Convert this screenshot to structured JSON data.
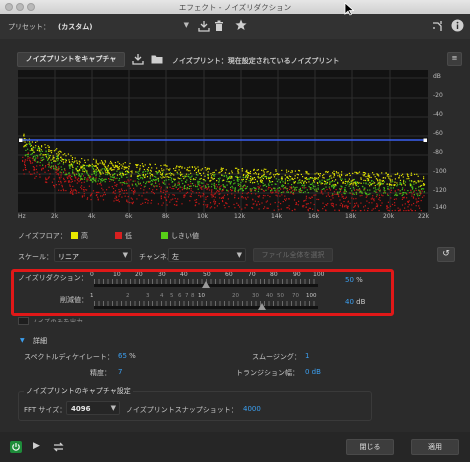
{
  "window": {
    "title": "エフェクト - ノイズリダクション"
  },
  "toolbar": {
    "preset_label": "プリセット：",
    "preset_value": "(カスタム)"
  },
  "capture": {
    "button_label": "ノイズプリントをキャプチャ",
    "status": "ノイズプリント：現在設定されているノイズプリント"
  },
  "graph": {
    "db_labels": [
      "dB",
      "-20",
      "-40",
      "-60",
      "-80",
      "-100",
      "-120",
      "-140"
    ],
    "hz_labels": [
      "Hz",
      "2k",
      "4k",
      "6k",
      "8k",
      "10k",
      "12k",
      "14k",
      "16k",
      "18k",
      "20k",
      "22k"
    ]
  },
  "legend": {
    "title": "ノイズフロア：",
    "items": [
      {
        "label": "高",
        "color": "#e8e800"
      },
      {
        "label": "低",
        "color": "#d82020"
      },
      {
        "label": "しきい値",
        "color": "#58d018"
      }
    ]
  },
  "controls": {
    "scale_label": "スケール：",
    "scale_value": "リニア",
    "channel_label": "チャンネル：",
    "channel_value": "左",
    "select_all_label": "ファイル全体を選択"
  },
  "sliders": {
    "reduction": {
      "label": "ノイズリダクション：",
      "ticks": [
        "0",
        "10",
        "20",
        "30",
        "40",
        "50",
        "60",
        "70",
        "80",
        "90",
        "100"
      ],
      "value": "50",
      "unit": "%",
      "level": 0.5
    },
    "attenuation": {
      "label": "削減値：",
      "ticks": [
        "1",
        "2",
        "3",
        "4",
        "5",
        "6",
        "7",
        "8",
        "10",
        "20",
        "30",
        "40",
        "50",
        "70",
        "100"
      ],
      "value": "40",
      "unit": "dB"
    }
  },
  "output_noise_label": "ノイズのみを出力",
  "advanced": {
    "header": "詳細",
    "spectral_decay_label": "スペクトルディケイレート：",
    "spectral_decay_value": "65",
    "spectral_decay_unit": "%",
    "smoothing_label": "スムージング：",
    "smoothing_value": "1",
    "precision_label": "精度：",
    "precision_value": "7",
    "transition_label": "トランジション幅：",
    "transition_value": "0 dB"
  },
  "capture_settings": {
    "title": "ノイズプリントのキャプチャ設定",
    "fft_label": "FFT サイズ：",
    "fft_value": "4096",
    "snapshots_label": "ノイズプリントスナップショット：",
    "snapshots_value": "4000"
  },
  "bottom": {
    "close_label": "閉じる",
    "apply_label": "適用"
  }
}
